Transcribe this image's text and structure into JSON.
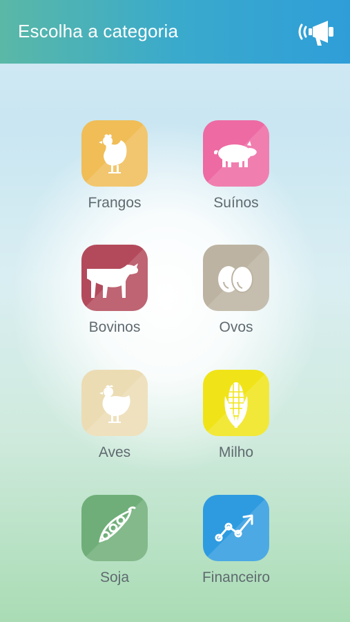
{
  "header": {
    "title": "Escolha a categoria",
    "action_icon": "megaphone-icon"
  },
  "categories": [
    {
      "label": "Frangos",
      "icon": "chicken-icon",
      "color": "#f0bd57"
    },
    {
      "label": "Suínos",
      "icon": "pig-icon",
      "color": "#ee6aa3"
    },
    {
      "label": "Bovinos",
      "icon": "cow-icon",
      "color": "#b34a5b"
    },
    {
      "label": "Ovos",
      "icon": "eggs-icon",
      "color": "#bcb3a2"
    },
    {
      "label": "Aves",
      "icon": "hen-icon",
      "color": "#ecdcb4"
    },
    {
      "label": "Milho",
      "icon": "corn-icon",
      "color": "#f0e418"
    },
    {
      "label": "Soja",
      "icon": "soybean-icon",
      "color": "#6fae78"
    },
    {
      "label": "Financeiro",
      "icon": "chart-line-icon",
      "color": "#2e9be0"
    }
  ],
  "colors": {
    "header_start": "#5ab8a6",
    "header_end": "#2f9ed8",
    "label_text": "#5f6a6f"
  }
}
